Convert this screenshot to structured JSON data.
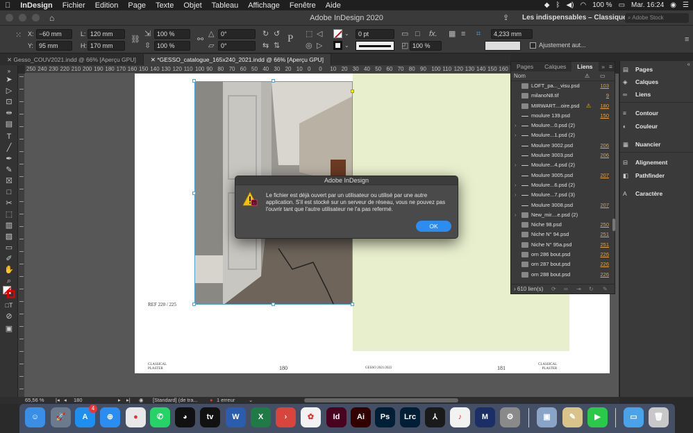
{
  "menubar": {
    "app": "InDesign",
    "items": [
      "Fichier",
      "Edition",
      "Page",
      "Texte",
      "Objet",
      "Tableau",
      "Affichage",
      "Fenêtre",
      "Aide"
    ],
    "battery": "100 %",
    "clock": "Mar. 16:24"
  },
  "window": {
    "title": "Adobe InDesign 2020",
    "workspace": "Les indispensables – Classique",
    "search_placeholder": "Adobe Stock"
  },
  "control": {
    "x_label": "X:",
    "x": "−60 mm",
    "y_label": "Y:",
    "y": "95 mm",
    "l_label": "L:",
    "l": "120 mm",
    "h_label": "H:",
    "h": "170 mm",
    "scale_x": "100 %",
    "scale_y": "100 %",
    "angle1": "0°",
    "angle2": "0°",
    "stroke_weight": "0 pt",
    "size": "4,233 mm",
    "opacity": "100 %",
    "autofit": "Ajustement aut..."
  },
  "doc_tabs": [
    {
      "label": "Gesso_COUV2021.indd @ 66% [Aperçu GPU]",
      "active": false
    },
    {
      "label": "*GESSO_catalogue_165x240_2021.indd @ 66% [Aperçu GPU]",
      "active": true
    }
  ],
  "ruler_ticks": [
    "250",
    "240",
    "230",
    "220",
    "210",
    "200",
    "190",
    "180",
    "170",
    "160",
    "150",
    "140",
    "130",
    "120",
    "110",
    "100",
    "90",
    "80",
    "70",
    "60",
    "50",
    "40",
    "30",
    "20",
    "10",
    "0",
    "0",
    "10",
    "20",
    "30",
    "40",
    "50",
    "60",
    "70",
    "80",
    "90",
    "100",
    "110",
    "120",
    "130",
    "140",
    "150",
    "160",
    "170"
  ],
  "page_left": {
    "ref": "REF 220 / 225",
    "footer_brand": "CLASSICAL\nPLASTER",
    "page_number": "180"
  },
  "page_right": {
    "footer_left": "GESSO 2021/2022",
    "page_number": "181",
    "footer_brand": "CLASSICAL\nPLASTER"
  },
  "links_panel": {
    "tabs": [
      "Pages",
      "Calques",
      "Liens"
    ],
    "active_tab": "Liens",
    "header": "Nom",
    "rows": [
      {
        "name": "LOFT_pa..._visu.psd",
        "page": "103",
        "expand": false,
        "thumb": "img",
        "warn": false
      },
      {
        "name": "milanoN8.tif",
        "page": "9",
        "expand": false,
        "thumb": "img",
        "warn": false
      },
      {
        "name": "MIRWART....oire.psd",
        "page": "180",
        "expand": false,
        "thumb": "img",
        "warn": true
      },
      {
        "name": "moulure 139.psd",
        "page": "150",
        "expand": false,
        "thumb": "line",
        "warn": false
      },
      {
        "name": "Moulure...0.psd (2)",
        "page": "",
        "expand": true,
        "thumb": "line",
        "warn": false
      },
      {
        "name": "Moulure...1.psd (2)",
        "page": "",
        "expand": true,
        "thumb": "line",
        "warn": false
      },
      {
        "name": "Moulure 3002.psd",
        "page": "206",
        "expand": false,
        "thumb": "line",
        "warn": false
      },
      {
        "name": "Moulure 3003.psd",
        "page": "206",
        "expand": false,
        "thumb": "line",
        "warn": false
      },
      {
        "name": "Moulure...4.psd (2)",
        "page": "",
        "expand": true,
        "thumb": "line",
        "warn": false
      },
      {
        "name": "Moulure 3005.psd",
        "page": "207",
        "expand": false,
        "thumb": "line",
        "warn": false
      },
      {
        "name": "Moulure...6.psd (2)",
        "page": "",
        "expand": true,
        "thumb": "line",
        "warn": false
      },
      {
        "name": "Moulure...7.psd (3)",
        "page": "",
        "expand": true,
        "thumb": "line",
        "warn": false
      },
      {
        "name": "Moulure 3008.psd",
        "page": "207",
        "expand": false,
        "thumb": "line",
        "warn": false
      },
      {
        "name": "New_mir....e.psd (2)",
        "page": "",
        "expand": true,
        "thumb": "img",
        "warn": false
      },
      {
        "name": "Niche 98.psd",
        "page": "250",
        "expand": false,
        "thumb": "img",
        "warn": false
      },
      {
        "name": "Niche N° 94.psd",
        "page": "251",
        "expand": false,
        "thumb": "img",
        "warn": false
      },
      {
        "name": "Niche N° 95a.psd",
        "page": "251",
        "expand": false,
        "thumb": "img",
        "warn": false
      },
      {
        "name": "orn 286 bout.psd",
        "page": "226",
        "expand": false,
        "thumb": "img",
        "warn": false
      },
      {
        "name": "orn 287 bout.psd",
        "page": "226",
        "expand": false,
        "thumb": "img",
        "warn": false
      },
      {
        "name": "orn 288 bout.psd",
        "page": "226",
        "expand": false,
        "thumb": "img",
        "warn": false
      }
    ],
    "footer": "610 lien(s)"
  },
  "right_panels": [
    {
      "label": "Pages",
      "icon": "pages-icon",
      "glyph": "▤"
    },
    {
      "label": "Calques",
      "icon": "layers-icon",
      "glyph": "◈"
    },
    {
      "label": "Liens",
      "icon": "links-icon",
      "glyph": "∞"
    },
    {
      "label": "Contour",
      "icon": "stroke-icon",
      "glyph": "≡"
    },
    {
      "label": "Couleur",
      "icon": "color-icon",
      "glyph": "◐"
    },
    {
      "label": "Nuancier",
      "icon": "swatches-icon",
      "glyph": "▦"
    },
    {
      "label": "Alignement",
      "icon": "align-icon",
      "glyph": "⊟"
    },
    {
      "label": "Pathfinder",
      "icon": "pathfinder-icon",
      "glyph": "◧"
    },
    {
      "label": "Caractère",
      "icon": "character-icon",
      "glyph": "A"
    }
  ],
  "status": {
    "zoom": "65,56 %",
    "page": "180",
    "style": "[Standard] (de tra...",
    "errors": "1 erreur"
  },
  "dialog": {
    "title": "Adobe InDesign",
    "message": "Le fichier est déjà ouvert par un utilisateur ou utilisé par une autre application. S'il est stocké sur un serveur de réseau, vous ne pouvez pas l'ouvrir tant que l'autre utilisateur ne l'a pas refermé.",
    "ok": "OK"
  },
  "dock": [
    {
      "name": "finder",
      "glyph": "☺",
      "color": "#3a8ee6"
    },
    {
      "name": "launchpad",
      "glyph": "🚀",
      "color": "#6b7a8c"
    },
    {
      "name": "app-store",
      "glyph": "A",
      "color": "#1f8ef1",
      "badge": "4"
    },
    {
      "name": "safari",
      "glyph": "⊕",
      "color": "#2b8df0"
    },
    {
      "name": "chrome",
      "glyph": "●",
      "color": "#e8e8e8"
    },
    {
      "name": "whatsapp",
      "glyph": "✆",
      "color": "#25d366"
    },
    {
      "name": "cat-app",
      "glyph": "◕",
      "color": "#111"
    },
    {
      "name": "apple-tv",
      "glyph": "tv",
      "color": "#111"
    },
    {
      "name": "word",
      "glyph": "W",
      "color": "#2b5cad"
    },
    {
      "name": "excel",
      "glyph": "X",
      "color": "#1f7a45"
    },
    {
      "name": "remote-desktop",
      "glyph": "›",
      "color": "#d9443c"
    },
    {
      "name": "photos",
      "glyph": "✿",
      "color": "#f2f2f2"
    },
    {
      "name": "indesign",
      "glyph": "Id",
      "color": "#49021f"
    },
    {
      "name": "illustrator",
      "glyph": "Ai",
      "color": "#330000"
    },
    {
      "name": "photoshop",
      "glyph": "Ps",
      "color": "#001e36"
    },
    {
      "name": "lightroom-classic",
      "glyph": "Lrc",
      "color": "#001e36"
    },
    {
      "name": "acrobat",
      "glyph": "⅄",
      "color": "#1a1a1a"
    },
    {
      "name": "music",
      "glyph": "♪",
      "color": "#f2f2f2"
    },
    {
      "name": "malwarebytes",
      "glyph": "M",
      "color": "#1b2f66"
    },
    {
      "name": "system-preferences",
      "glyph": "⚙",
      "color": "#8a8a8a"
    },
    {
      "name": "preview",
      "glyph": "▣",
      "color": "#8aa4c8"
    },
    {
      "name": "script-editor",
      "glyph": "✎",
      "color": "#d9c38a"
    },
    {
      "name": "facetime",
      "glyph": "▶",
      "color": "#2ac94a"
    },
    {
      "name": "downloads-folder",
      "glyph": "▭",
      "color": "#4aa3e8"
    },
    {
      "name": "trash",
      "glyph": "🗑",
      "color": "#c8c8c8"
    }
  ]
}
